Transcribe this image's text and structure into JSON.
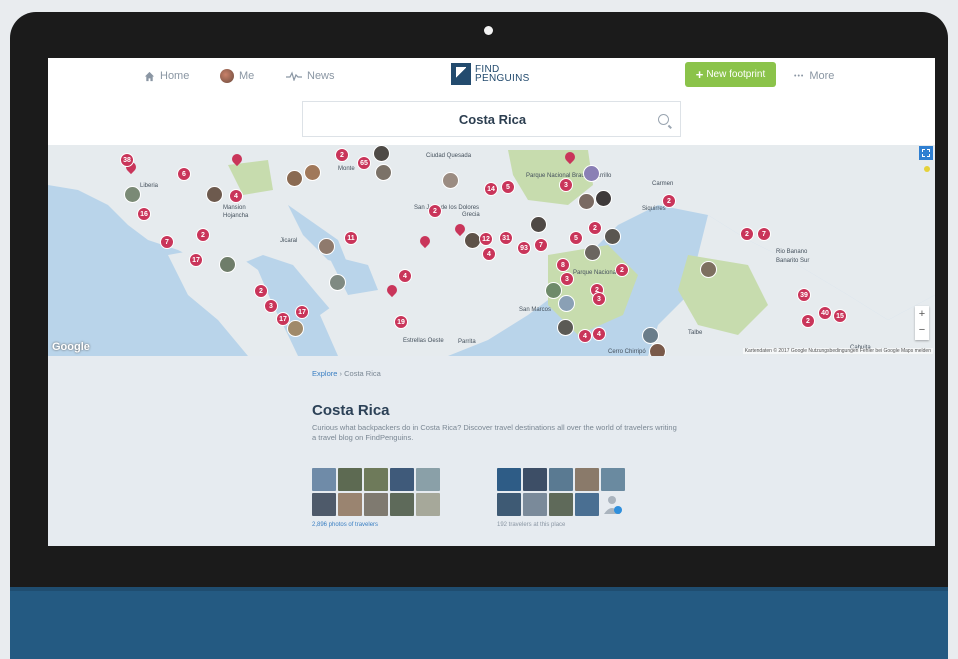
{
  "nav": {
    "home": "Home",
    "me": "Me",
    "news": "News",
    "more": "More",
    "more_dots": "•••",
    "new_footprint": "New footprint",
    "plus": "+"
  },
  "logo": {
    "line1": "FIND",
    "line2": "PENGUINS"
  },
  "search": {
    "value": "Costa Rica"
  },
  "map": {
    "google": "Google",
    "attribution": "Kartendaten © 2017 Google   Nutzungsbedingungen   Fehler bei Google Maps melden",
    "zoom_in": "+",
    "zoom_out": "−",
    "clusters": [
      "38",
      "6",
      "2",
      "65",
      "4",
      "14",
      "5",
      "3",
      "2",
      "16",
      "7",
      "2",
      "2",
      "11",
      "12",
      "31",
      "93",
      "7",
      "5",
      "2",
      "4",
      "2",
      "7",
      "17",
      "4",
      "8",
      "2",
      "3",
      "2",
      "3",
      "17",
      "17",
      "19",
      "4",
      "4",
      "2",
      "39",
      "40",
      "15",
      "2",
      "3"
    ],
    "places": [
      "Ciudad Quesada",
      "Parque Nacional Braulio Carrillo",
      "Liberia",
      "Carmen",
      "Siquirres",
      "Mansion",
      "Hojancha",
      "San José de los Dolores",
      "Grecia",
      "Jicaral",
      "Rio Banano",
      "Banarito Sur",
      "San Marcos",
      "Parque Nacional",
      "Talbe",
      "Estrellas Oeste",
      "Parrita",
      "Cerro Chirripó",
      "Monte",
      "Cahuita"
    ]
  },
  "content": {
    "breadcrumb_link": "Explore",
    "breadcrumb_sep": "›",
    "breadcrumb_current": "Costa Rica",
    "title": "Costa Rica",
    "description": "Curious what backpackers do in Costa Rica? Discover travel destinations all over the world of travelers writing a travel blog on FindPenguins.",
    "photos_caption": "2,896 photos of travelers",
    "travelers_caption": "192 travelers at this place"
  },
  "colors": {
    "cluster": "#c9355a",
    "accent_green": "#8bc34a",
    "brand_navy": "#234b6e",
    "water": "#b9d4ea",
    "land": "#e6ebee",
    "park": "#c7dcae",
    "monitor_base": "#245a82"
  }
}
